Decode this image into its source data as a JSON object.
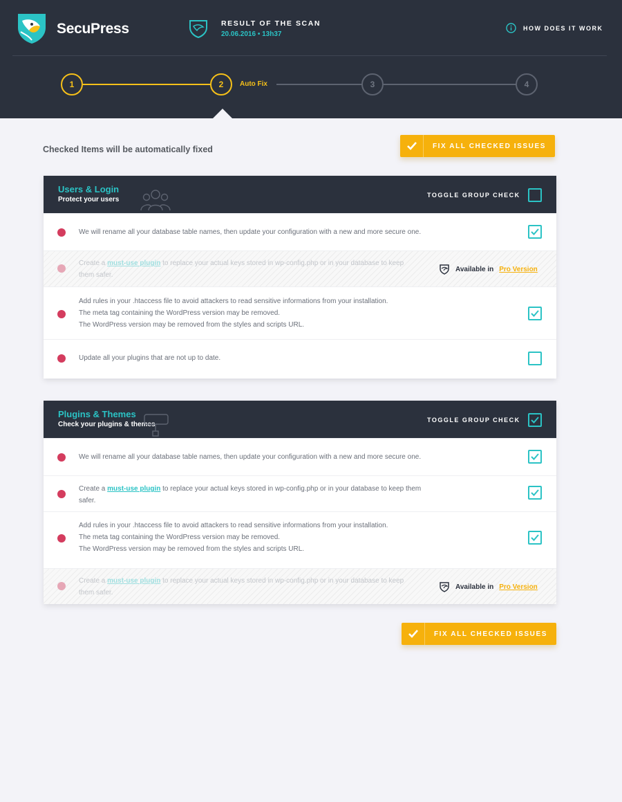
{
  "header": {
    "brand": "SecuPress",
    "scan_title": "RESULT OF THE SCAN",
    "scan_date": "20.06.2016 • 13h37",
    "how_it_works": "HOW DOES IT WORK",
    "steps": [
      {
        "number": "1",
        "state": "done"
      },
      {
        "number": "2",
        "state": "active",
        "label": "Auto Fix"
      },
      {
        "number": "3",
        "state": "pending"
      },
      {
        "number": "4",
        "state": "pending"
      }
    ]
  },
  "main": {
    "intro": "Checked Items will be automatically fixed",
    "fix_button_label": "FIX ALL CHECKED ISSUES"
  },
  "colors": {
    "header_bg": "#2b313d",
    "accent_teal": "#2bc3c5",
    "accent_yellow": "#f6c019",
    "button_orange": "#f6b10c",
    "status_red": "#d43c5e"
  },
  "groups": [
    {
      "title": "Users & Login",
      "subtitle": "Protect your users",
      "icon": "users-icon",
      "toggle_label": "TOGGLE GROUP CHECK",
      "toggle_checked": false,
      "items": [
        {
          "lines": [
            "We will rename all your database table names, then update your configuration with a new and more secure one."
          ],
          "checked": true,
          "pro": false
        },
        {
          "pre": "Create a ",
          "link": "must-use plugin",
          "post": " to replace your actual keys stored in wp-config.php or in your database to keep them safer.",
          "checked": false,
          "pro": true
        },
        {
          "lines": [
            "Add rules in your .htaccess file to avoid attackers to read sensitive informations from your installation.",
            "The meta tag containing the WordPress version may be removed.",
            "The WordPress version may be removed from the styles and scripts URL."
          ],
          "checked": true,
          "pro": false
        },
        {
          "lines": [
            "Update all your plugins that are not up to date."
          ],
          "checked": false,
          "pro": false
        }
      ]
    },
    {
      "title": "Plugins & Themes",
      "subtitle": "Check your plugins & themes",
      "icon": "plugin-icon",
      "toggle_label": "TOGGLE GROUP CHECK",
      "toggle_checked": true,
      "items": [
        {
          "lines": [
            "We will rename all your database table names, then update your configuration with a new and more secure one."
          ],
          "checked": true,
          "pro": false
        },
        {
          "pre": "Create a ",
          "link": "must-use plugin",
          "post": " to replace your actual keys stored in wp-config.php or in your database to keep them safer.",
          "checked": true,
          "pro": false
        },
        {
          "lines": [
            "Add rules in your .htaccess file to avoid attackers to read sensitive informations from your installation.",
            "The meta tag containing the WordPress version may be removed.",
            "The WordPress version may be removed from the styles and scripts URL."
          ],
          "checked": true,
          "pro": false
        },
        {
          "pre": "Create a ",
          "link": "must-use plugin",
          "post": " to replace your actual keys stored in wp-config.php or in your database to keep them safer.",
          "checked": false,
          "pro": true
        }
      ]
    }
  ],
  "pro": {
    "available_in": "Available in",
    "version_link": "Pro Version"
  }
}
